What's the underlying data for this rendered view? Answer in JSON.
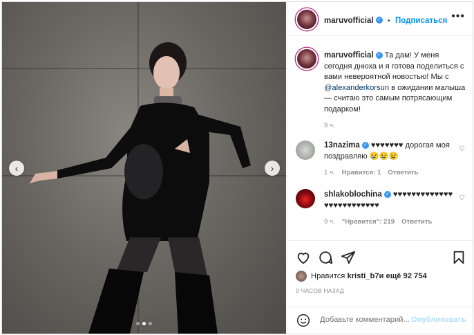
{
  "post": {
    "username": "maruvofficial",
    "follow_label": "Подписаться",
    "separator": "•",
    "more_label": "•••",
    "caption": {
      "username": "maruvofficial",
      "text_before": " Та дам! У меня сегодня днюха и я готова поделиться с вами невероятной новостью! Мы с ",
      "mention": "@alexanderkorsun",
      "text_after": " в ожидании малыша — считаю это самым потрясающим подарком!",
      "time": "9 ч."
    },
    "comments": [
      {
        "username": "13nazima",
        "text": " ♥♥♥♥♥♥♥ дорогая моя поздравляю 😢😢😢",
        "time": "1 ч.",
        "likes": "Нравится: 1",
        "reply": "Ответить"
      },
      {
        "username": "shlakoblochina",
        "text": " ♥♥♥♥♥♥♥♥♥♥♥♥♥♥♥♥♥♥♥♥♥♥♥♥♥",
        "time": "9 ч.",
        "likes": "\"Нравится\": 219",
        "reply": "Ответить"
      }
    ],
    "likes_prefix": "Нравится ",
    "likes_user": "kristi_b7",
    "likes_suffix": " и ещё 92 754",
    "posted_ago": "9 ЧАСОВ НАЗАД",
    "add_comment_placeholder": "Добавьте комментарий...",
    "publish_label": "Опубликовать"
  },
  "carousel": {
    "prev_label": "‹",
    "next_label": "›",
    "active_index": 2,
    "count": 3
  },
  "colors": {
    "accent": "#0095f6",
    "muted": "#8e8e8e",
    "text": "#262626"
  }
}
